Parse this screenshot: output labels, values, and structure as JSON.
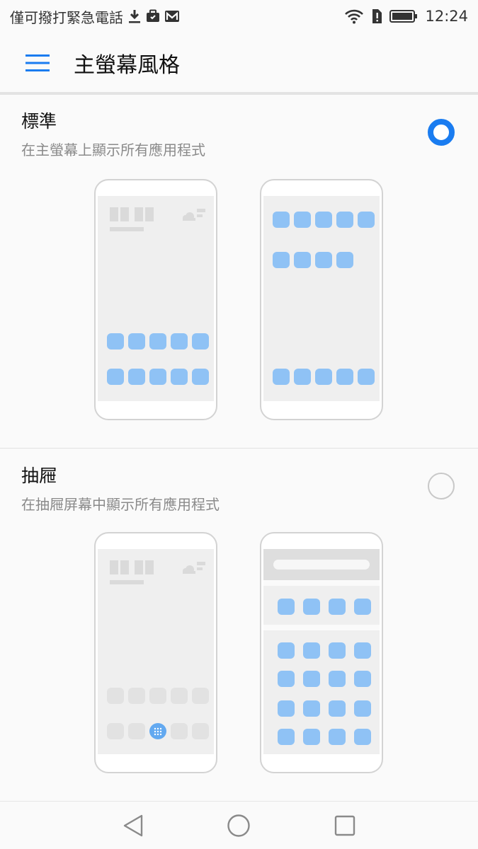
{
  "status_bar": {
    "carrier_text": "僅可撥打緊急電話",
    "time": "12:24",
    "icons": [
      "download-icon",
      "briefcase-icon",
      "gmail-icon",
      "wifi-icon",
      "sim-alert-icon",
      "battery-icon"
    ]
  },
  "app_bar": {
    "title": "主螢幕風格",
    "menu_icon": "menu-icon"
  },
  "options": [
    {
      "id": "standard",
      "title": "標準",
      "description": "在主螢幕上顯示所有應用程式",
      "selected": true
    },
    {
      "id": "drawer",
      "title": "抽屜",
      "description": "在抽屜屏幕中顯示所有應用程式",
      "selected": false
    }
  ],
  "nav_bar": {
    "icons": [
      "back-icon",
      "home-icon",
      "recents-icon"
    ]
  },
  "colors": {
    "accent": "#1a7cf0",
    "app_icon": "#8fc2f5",
    "screen_bg": "#efefef"
  }
}
